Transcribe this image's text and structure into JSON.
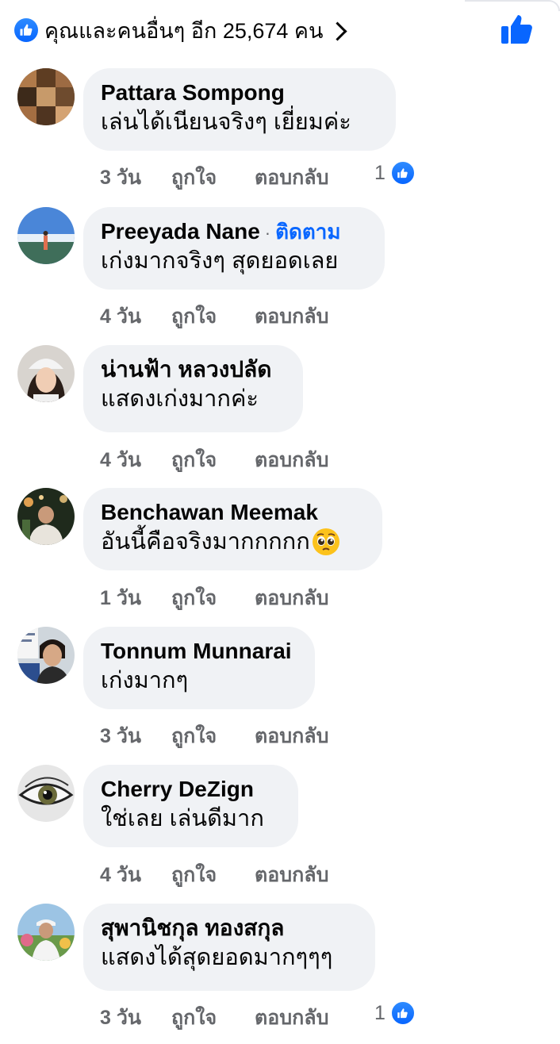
{
  "reactions": {
    "summary": "คุณและคนอื่นๆ อีก 25,674 คน",
    "icon": "like-icon"
  },
  "colors": {
    "accent": "#0866ff",
    "bubble": "#f0f2f5",
    "meta": "#65676b"
  },
  "actions": {
    "like": "ถูกใจ",
    "reply": "ตอบกลับ"
  },
  "comments": [
    {
      "author": "Pattara Sompong",
      "text": "เล่นได้เนียนจริงๆ เยี่ยมค่ะ",
      "time": "3 วัน",
      "likes": "1",
      "avatar": "avatar-collage"
    },
    {
      "author": "Preeyada Nane",
      "follow": "ติดตาม",
      "text": "เก่งมากจริงๆ สุดยอดเลย",
      "time": "4 วัน",
      "avatar": "avatar-sky"
    },
    {
      "author": "น่านฟ้า หลวงปลัด",
      "text": "แสดงเก่งมากค่ะ",
      "time": "4 วัน",
      "avatar": "avatar-woman-cap"
    },
    {
      "author": "Benchawan Meemak",
      "text": "อันนี้คือจริงมากกกกก",
      "emoji": "pleading-face-emoji",
      "time": "1 วัน",
      "avatar": "avatar-night-street"
    },
    {
      "author": "Tonnum Munnarai",
      "text": "เก่งมากๆ",
      "time": "3 วัน",
      "avatar": "avatar-woman-sign"
    },
    {
      "author": "Cherry DeZign",
      "text": "ใช่เลย เล่นดีมาก",
      "time": "4 วัน",
      "avatar": "avatar-eye"
    },
    {
      "author": "สุพานิชกุล ทองสกุล",
      "text": "แสดงได้สุดยอดมากๆๆๆ",
      "time": "3 วัน",
      "likes": "1",
      "avatar": "avatar-garden-man"
    }
  ]
}
